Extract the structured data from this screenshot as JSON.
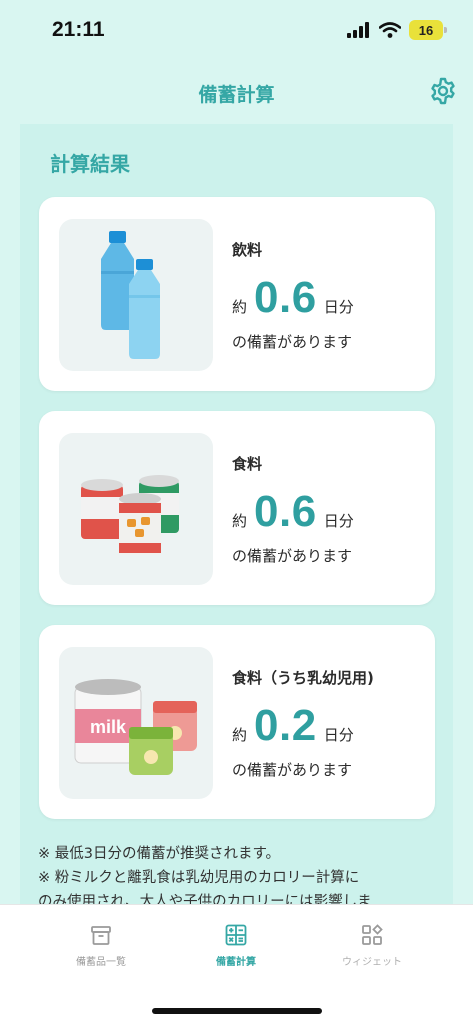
{
  "status_bar": {
    "time": "21:11",
    "battery": "16"
  },
  "header": {
    "title": "備蓄計算"
  },
  "section_title": "計算結果",
  "cards": [
    {
      "label": "飲料",
      "prefix": "約",
      "value": "0.6",
      "unit": "日分",
      "caption": "の備蓄があります"
    },
    {
      "label": "食料",
      "prefix": "約",
      "value": "0.6",
      "unit": "日分",
      "caption": "の備蓄があります"
    },
    {
      "label": "食料（うち乳幼児用)",
      "prefix": "約",
      "value": "0.2",
      "unit": "日分",
      "caption": "の備蓄があります",
      "can_text": "milk"
    }
  ],
  "notes": [
    "※ 最低3日分の備蓄が推奨されます。",
    "※ 粉ミルクと離乳食は乳幼児用のカロリー計算に",
    "のみ使用され、大人や子供のカロリーには影響しま"
  ],
  "tabs": [
    {
      "label": "備蓄品一覧",
      "icon": "box-icon",
      "active": false
    },
    {
      "label": "備蓄計算",
      "icon": "calculator-icon",
      "active": true
    },
    {
      "label": "ウィジェット",
      "icon": "widget-icon",
      "active": false
    }
  ],
  "colors": {
    "accent": "#35a7a5",
    "background": "#d9f6f1",
    "inactive": "#9a9a9a"
  }
}
